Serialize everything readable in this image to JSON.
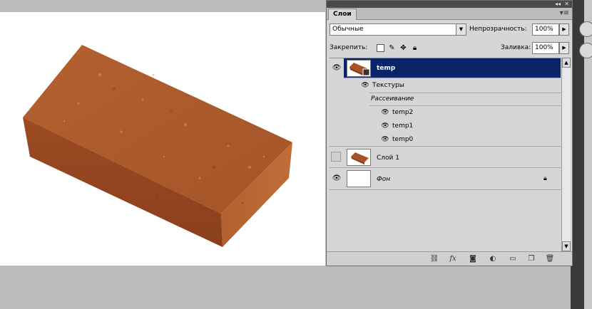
{
  "panel": {
    "tab_label": "Слои",
    "menu_icon": "panel-menu-icon",
    "collapse_icon": "double-left-arrow-icon",
    "close_icon": "close-icon"
  },
  "blend": {
    "mode": "Обычные",
    "opacity_label": "Непрозрачность:",
    "opacity_value": "100%"
  },
  "lock": {
    "label": "Закрепить:",
    "icons": [
      "lock-transparent-icon",
      "lock-brush-icon",
      "lock-move-icon",
      "lock-all-icon"
    ],
    "fill_label": "Заливка:",
    "fill_value": "100%"
  },
  "layers": {
    "temp": {
      "name": "temp",
      "visible": true,
      "selected": true
    },
    "effects_label": "Текстуры",
    "scatter_label": "Рассеивание",
    "effects": [
      "temp2",
      "temp1",
      "temp0"
    ],
    "layer1": {
      "name": "Слой 1",
      "visible": false
    },
    "background": {
      "name": "Фон",
      "visible": true,
      "locked": true
    }
  },
  "bottom_icons": [
    "link-icon",
    "fx-icon",
    "mask-icon",
    "adjustment-icon",
    "folder-icon",
    "new-layer-icon",
    "trash-icon"
  ],
  "colors": {
    "selection": "#0a246a",
    "panel_bg": "#d6d6d6",
    "brick": "#a8532a"
  }
}
